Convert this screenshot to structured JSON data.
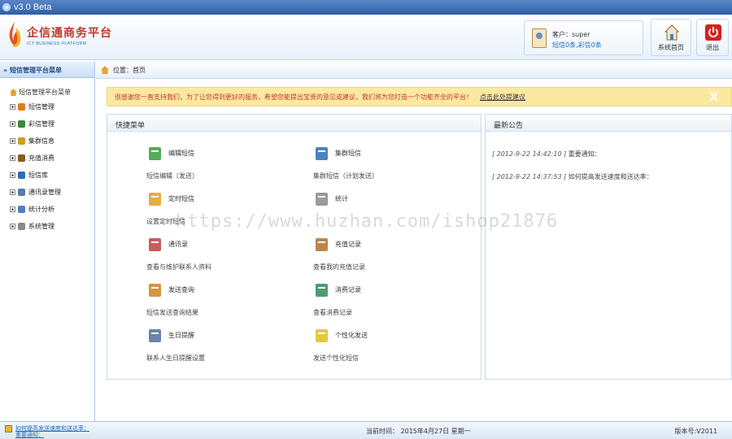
{
  "window": {
    "title": "v3.0  Beta"
  },
  "header": {
    "logo_name": "企信通商务平台",
    "logo_sub": "ICT BUSINESS PLATFORM",
    "user_line1": "客户：super",
    "user_line2": "短信0条,彩信0条",
    "home_label": "系统首页",
    "logout_label": "退出"
  },
  "sidebar": {
    "title": "» 短信管理平台菜单",
    "root": "短信管理平台菜单",
    "items": [
      {
        "label": "短信管理",
        "icon": "sms-icon",
        "color": "#e07b22"
      },
      {
        "label": "彩信管理",
        "icon": "mms-icon",
        "color": "#3a8a3a"
      },
      {
        "label": "集群信息",
        "icon": "cluster-icon",
        "color": "#c9a020"
      },
      {
        "label": "充值消费",
        "icon": "recharge-icon",
        "color": "#8a5a20"
      },
      {
        "label": "短信库",
        "icon": "library-icon",
        "color": "#2f6db5"
      },
      {
        "label": "通讯录管理",
        "icon": "contacts-icon",
        "color": "#5a7aa0"
      },
      {
        "label": "统计分析",
        "icon": "stats-icon",
        "color": "#4f7fc0"
      },
      {
        "label": "系统管理",
        "icon": "settings-icon",
        "color": "#8a8a8a"
      }
    ]
  },
  "breadcrumb": {
    "text": "位置：首页"
  },
  "notice": {
    "text": "很感谢您一直支持我们，为了让您得到更好的服务，希望您能提出宝贵的意见或建议，我们将为您打造一个功能齐全的平台！",
    "link": "点击此处提建议",
    "close": "X"
  },
  "quick_menu": {
    "title": "快捷菜单",
    "items": [
      {
        "title": "编辑短信",
        "desc": "短信编辑（发送）",
        "icon": "edit-sms-icon"
      },
      {
        "title": "集群短信",
        "desc": "集群短信（计划发送）",
        "icon": "group-sms-icon"
      },
      {
        "title": "定时短信",
        "desc": "设置定时短信",
        "icon": "alarm-clock-icon"
      },
      {
        "title": "统计",
        "desc": "",
        "icon": "chart-icon"
      },
      {
        "title": "通讯录",
        "desc": "查看与维护联系人资料",
        "icon": "address-book-icon"
      },
      {
        "title": "充值记录",
        "desc": "查看我的充值记录",
        "icon": "recharge-record-icon"
      },
      {
        "title": "发送查询",
        "desc": "短信发送查询结果",
        "icon": "send-query-icon"
      },
      {
        "title": "消费记录",
        "desc": "查看消费记录",
        "icon": "download-icon"
      },
      {
        "title": "生日提醒",
        "desc": "联系人生日提醒设置",
        "icon": "birthday-icon"
      },
      {
        "title": "个性化发送",
        "desc": "发送个性化短信",
        "icon": "lightbulb-icon"
      }
    ]
  },
  "news": {
    "title": "最新公告",
    "items": [
      {
        "date": "[ 2012-9-22 14:42:10 ]",
        "text": "重要通知："
      },
      {
        "date": "[ 2012-9-22 14:37:53 ]",
        "text": "如何提高发送速度和送达率："
      }
    ]
  },
  "watermark": "https://www.huzhan.com/ishop21876",
  "footer": {
    "notice_line1": "如何提高发送速度和送达率：",
    "notice_line2": "重要通知：",
    "time": "当前时间： 2015年4月27日 星期一",
    "version": "版本号:V2011"
  }
}
